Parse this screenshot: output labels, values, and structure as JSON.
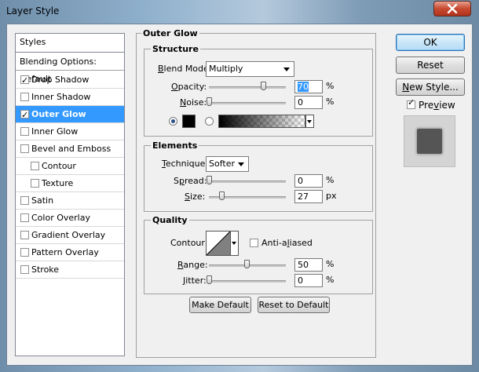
{
  "window": {
    "title": "Layer Style"
  },
  "styles_list": {
    "header": "Styles",
    "blending": "Blending Options: Default",
    "items": [
      {
        "label": "Drop Shadow",
        "checked": true,
        "selected": false,
        "indent": false
      },
      {
        "label": "Inner Shadow",
        "checked": false,
        "selected": false,
        "indent": false
      },
      {
        "label": "Outer Glow",
        "checked": true,
        "selected": true,
        "indent": false
      },
      {
        "label": "Inner Glow",
        "checked": false,
        "selected": false,
        "indent": false
      },
      {
        "label": "Bevel and Emboss",
        "checked": false,
        "selected": false,
        "indent": false
      },
      {
        "label": "Contour",
        "checked": false,
        "selected": false,
        "indent": true
      },
      {
        "label": "Texture",
        "checked": false,
        "selected": false,
        "indent": true
      },
      {
        "label": "Satin",
        "checked": false,
        "selected": false,
        "indent": false
      },
      {
        "label": "Color Overlay",
        "checked": false,
        "selected": false,
        "indent": false
      },
      {
        "label": "Gradient Overlay",
        "checked": false,
        "selected": false,
        "indent": false
      },
      {
        "label": "Pattern Overlay",
        "checked": false,
        "selected": false,
        "indent": false
      },
      {
        "label": "Stroke",
        "checked": false,
        "selected": false,
        "indent": false
      }
    ]
  },
  "outer_glow": {
    "title": "Outer Glow",
    "structure": {
      "title": "Structure",
      "blend_mode_label": "Blend Mode:",
      "blend_mode_value": "Multiply",
      "opacity_label": "Opacity:",
      "opacity_value": "70",
      "noise_label": "Noise:",
      "noise_value": "0",
      "percent": "%",
      "glow_color": "#000000"
    },
    "elements": {
      "title": "Elements",
      "technique_label": "Technique:",
      "technique_value": "Softer",
      "spread_label": "Spread:",
      "spread_value": "0",
      "size_label": "Size:",
      "size_value": "27",
      "percent": "%",
      "px": "px"
    },
    "quality": {
      "title": "Quality",
      "contour_label": "Contour:",
      "anti_aliased_label": "Anti-aliased",
      "range_label": "Range:",
      "range_value": "50",
      "jitter_label": "Jitter:",
      "jitter_value": "0",
      "percent": "%"
    },
    "make_default": "Make Default",
    "reset_default": "Reset to Default"
  },
  "buttons": {
    "ok": "OK",
    "reset": "Reset",
    "new_style": "New Style...",
    "preview_label": "Preview",
    "preview_checked": true
  },
  "colors": {
    "selection": "#3399ff",
    "preview_swatch": "#555555"
  }
}
